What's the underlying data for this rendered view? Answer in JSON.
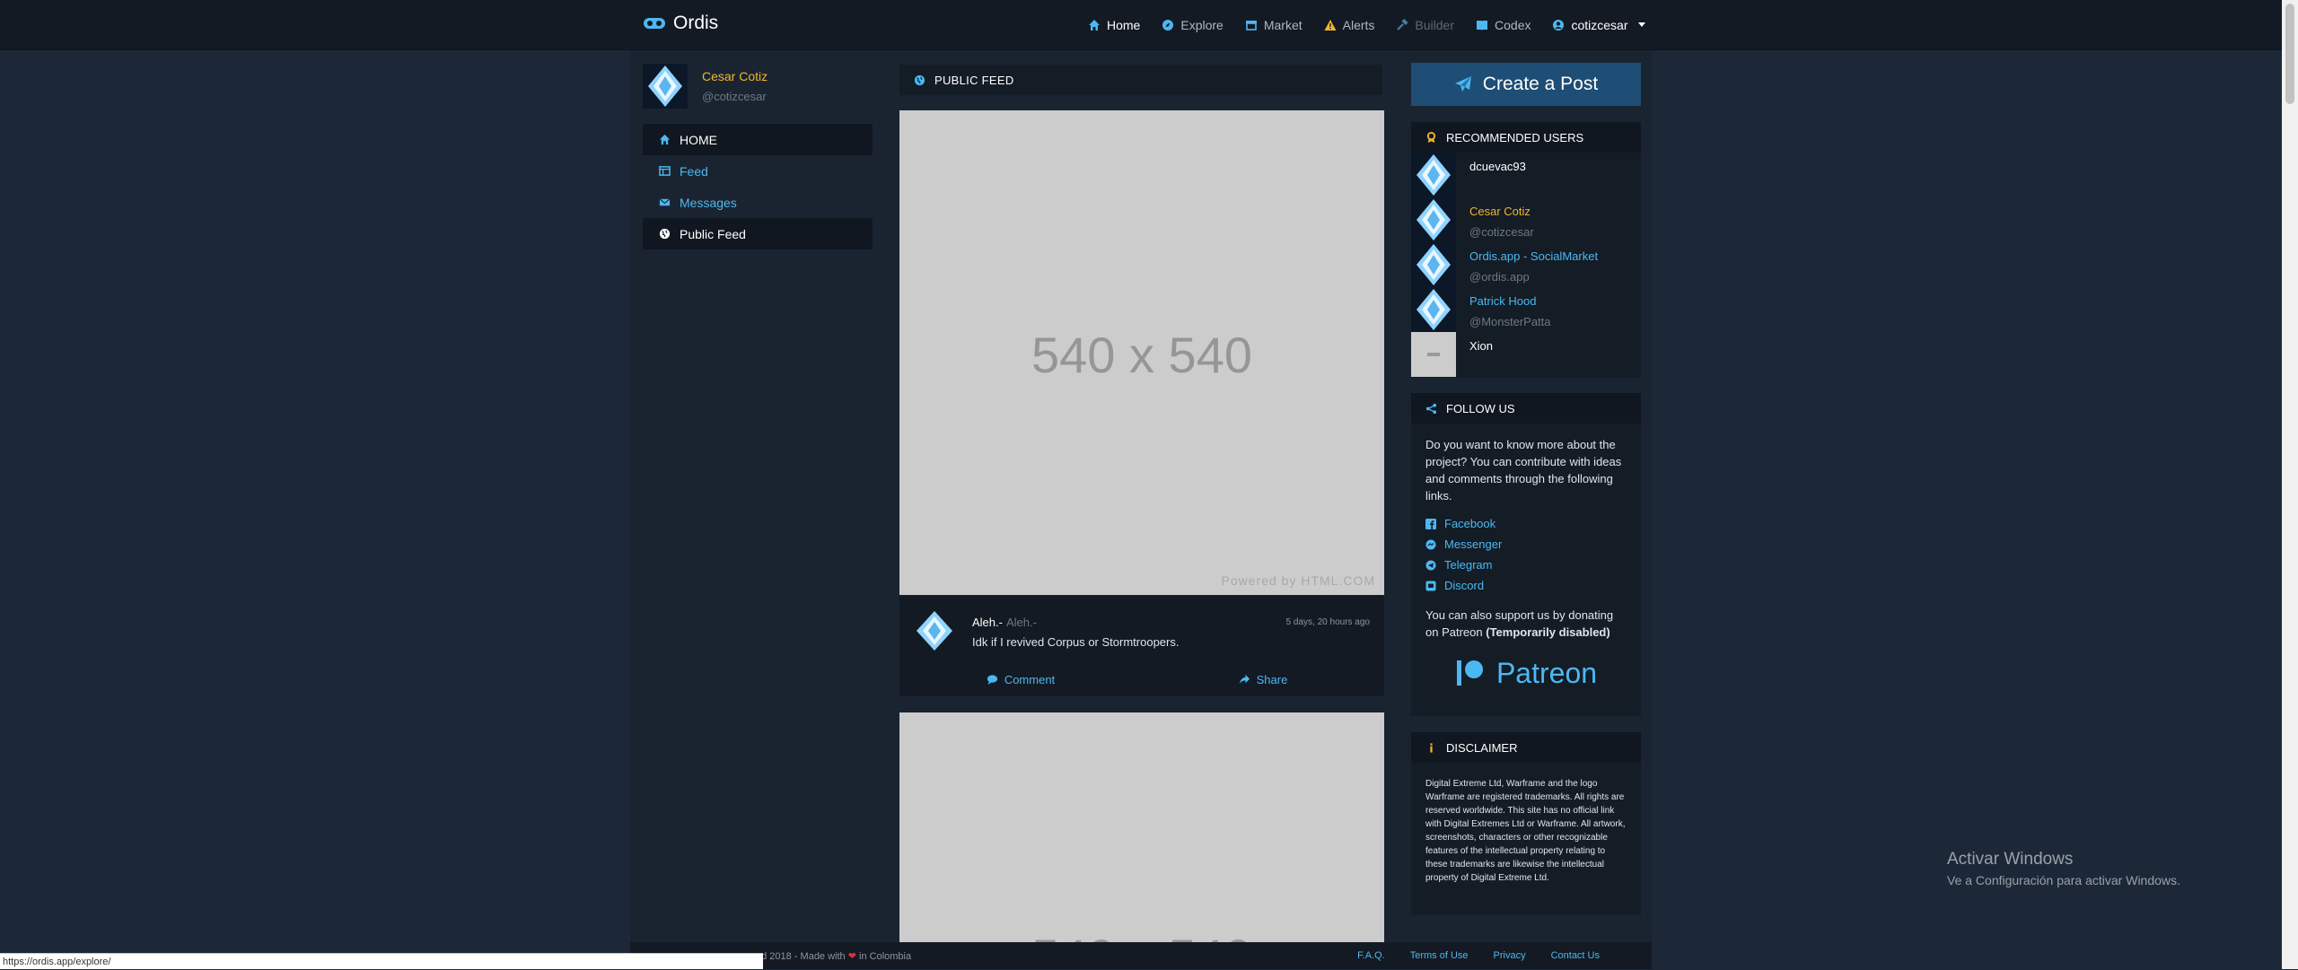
{
  "brand": {
    "name": "Ordis",
    "icon": "gamepad-icon"
  },
  "nav": {
    "items": [
      {
        "label": "Home",
        "icon": "home-icon",
        "state": "active"
      },
      {
        "label": "Explore",
        "icon": "compass-icon",
        "state": "normal"
      },
      {
        "label": "Market",
        "icon": "market-icon",
        "state": "normal"
      },
      {
        "label": "Alerts",
        "icon": "warning-icon",
        "state": "normal"
      },
      {
        "label": "Builder",
        "icon": "hammer-icon",
        "state": "disabled"
      },
      {
        "label": "Codex",
        "icon": "book-icon",
        "state": "normal"
      }
    ],
    "user": "cotizcesar"
  },
  "profile": {
    "name": "Cesar Cotiz",
    "handle": "@cotizcesar"
  },
  "sidenav": {
    "header": "HOME",
    "items": [
      {
        "label": "Feed",
        "icon": "table-icon"
      },
      {
        "label": "Messages",
        "icon": "envelope-icon"
      },
      {
        "label": "Public Feed",
        "icon": "globe-icon"
      }
    ]
  },
  "feed": {
    "title": "PUBLIC FEED",
    "placeholder_text": "540 x 540",
    "placeholder_credit": "Powered by HTML.COM",
    "post": {
      "author": "Aleh.-",
      "author_sub": "Aleh.-",
      "time": "5 days, 20 hours ago",
      "text": "Idk if I revived Corpus or Stormtroopers.",
      "comment_label": "Comment",
      "share_label": "Share"
    }
  },
  "sidebar_right": {
    "create_post": "Create a Post",
    "recommended": {
      "title": "RECOMMENDED USERS",
      "users": [
        {
          "name": "dcuevac93",
          "handle": "",
          "color": "#ffffff"
        },
        {
          "name": "Cesar Cotiz",
          "handle": "@cotizcesar",
          "color": "#f1b62d"
        },
        {
          "name": "Ordis.app - SocialMarket",
          "handle": "@ordis.app",
          "color": "#4cb8f2"
        },
        {
          "name": "Patrick Hood",
          "handle": "@MonsterPatta",
          "color": "#4cb8f2"
        },
        {
          "name": "Xion",
          "handle": "",
          "color": "#ffffff"
        }
      ]
    },
    "follow": {
      "title": "FOLLOW US",
      "text": "Do you want to know more about the project? You can contribute with ideas and comments through the following links.",
      "links": [
        {
          "label": "Facebook",
          "icon": "facebook-icon"
        },
        {
          "label": "Messenger",
          "icon": "messenger-icon"
        },
        {
          "label": "Telegram",
          "icon": "telegram-icon"
        },
        {
          "label": "Discord",
          "icon": "discord-icon"
        }
      ],
      "support_text": "You can also support us by donating on Patreon",
      "support_note": "(Temporarily disabled)",
      "patreon_label": "Patreon"
    },
    "disclaimer": {
      "title": "DISCLAIMER",
      "text": "Digital Extreme Ltd, Warframe and the logo Warframe are registered trademarks. All rights are reserved worldwide. This site has no official link with Digital Extremes Ltd or Warframe. All artwork, screenshots, characters or other recognizable features of the intellectual property relating to these trademarks are likewise the intellectual property of Digital Extreme Ltd."
    }
  },
  "footer": {
    "left_prefix": "ed 2018 - Made with",
    "left_suffix": "in Colombia",
    "links": [
      "F.A.Q.",
      "Terms of Use",
      "Privacy",
      "Contact Us"
    ]
  },
  "statusbar_url": "https://ordis.app/explore/",
  "windows_activation": {
    "title": "Activar Windows",
    "subtitle": "Ve a Configuración para activar Windows."
  }
}
